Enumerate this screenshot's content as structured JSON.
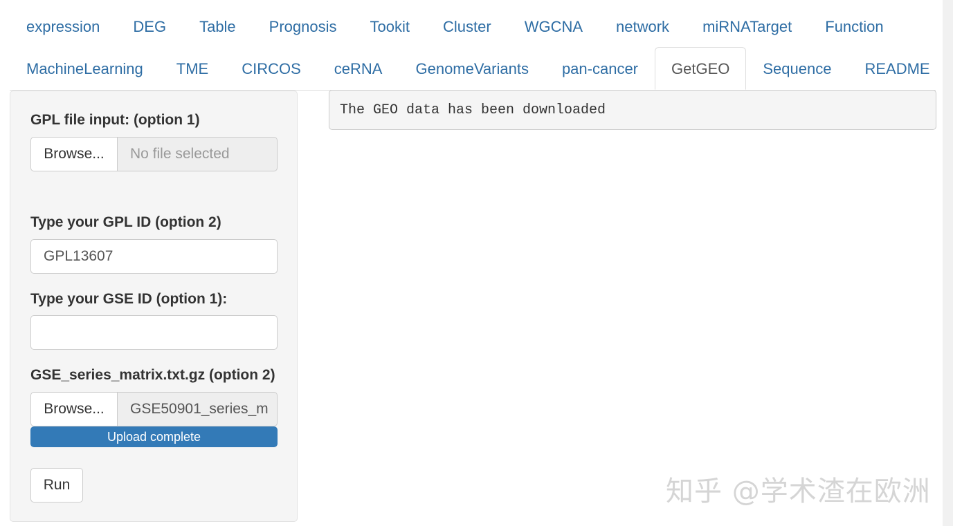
{
  "tabs": {
    "row1": [
      "expression",
      "DEG",
      "Table",
      "Prognosis",
      "Tookit",
      "Cluster",
      "WGCNA",
      "network",
      "miRNATarget",
      "Function"
    ],
    "row2": [
      "MachineLearning",
      "TME",
      "CIRCOS",
      "ceRNA",
      "GenomeVariants",
      "pan-cancer",
      "GetGEO",
      "Sequence",
      "README"
    ],
    "active": "GetGEO"
  },
  "sidebar": {
    "gpl_file": {
      "label": "GPL file input: (option 1)",
      "browse_label": "Browse...",
      "file_name": "No file selected"
    },
    "gpl_id": {
      "label": "Type your GPL ID (option 2)",
      "value": "GPL13607"
    },
    "gse_id": {
      "label": "Type your GSE ID (option 1):",
      "value": ""
    },
    "gse_matrix": {
      "label": "GSE_series_matrix.txt.gz (option 2)",
      "browse_label": "Browse...",
      "file_name": "GSE50901_series_m"
    },
    "upload": {
      "text": "Upload complete",
      "progress": 100
    },
    "run_label": "Run"
  },
  "output": {
    "text": "The GEO data has been downloaded"
  },
  "watermark": "知乎 @学术渣在欧洲",
  "colors": {
    "link": "#2e6da4",
    "progress": "#337ab7",
    "panel": "#f5f5f5"
  }
}
